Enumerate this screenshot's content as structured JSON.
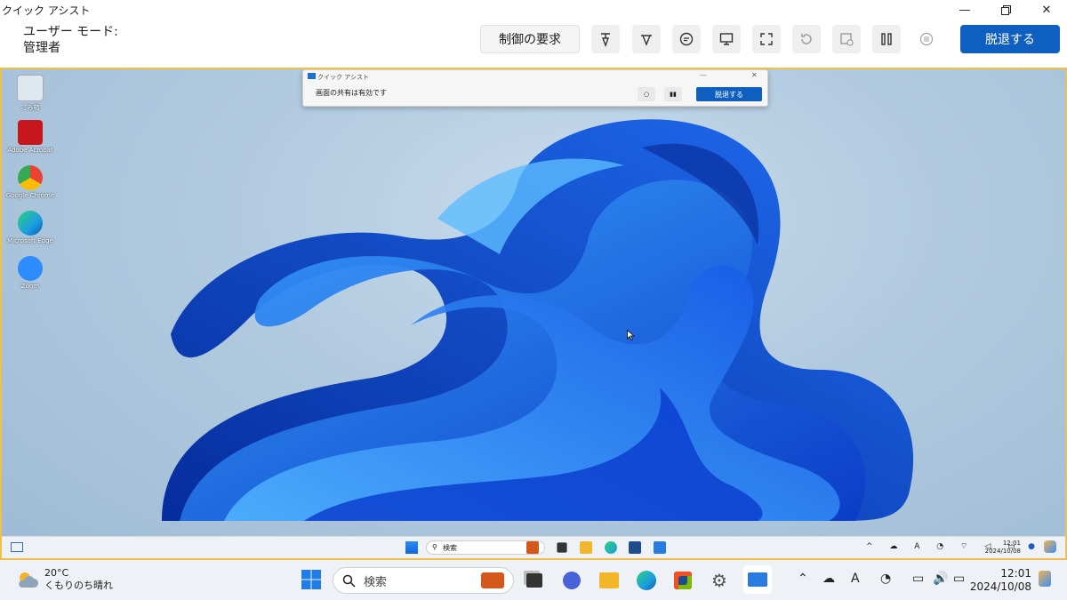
{
  "titlebar": {
    "title": "クイック アシスト"
  },
  "toolbar": {
    "mode_label": "ユーザー モード:",
    "mode_value": "管理者",
    "request_control_label": "制御の要求",
    "leave_label": "脱退する"
  },
  "remote": {
    "desktop_icons": [
      {
        "label": "ごみ箱",
        "icon": "recycle-bin-icon",
        "color": "#dfe7ef"
      },
      {
        "label": "Adobe Acrobat",
        "icon": "acrobat-icon",
        "color": "#c8161d"
      },
      {
        "label": "Google Chrome",
        "icon": "chrome-icon",
        "color": "#f1c40f"
      },
      {
        "label": "Microsoft Edge",
        "icon": "edge-icon",
        "color": "#1b9de2"
      },
      {
        "label": "Zoom",
        "icon": "zoom-icon",
        "color": "#2d8cff"
      }
    ],
    "window": {
      "title": "クイック アシスト",
      "message": "画面の共有は有効です",
      "leave_label": "脱退する"
    },
    "taskbar": {
      "search_label": "検索",
      "time": "12:01",
      "date": "2024/10/08"
    }
  },
  "taskbar": {
    "weather_temp": "20°C",
    "weather_text": "くもりのち晴れ",
    "search_label": "検索",
    "tray_ime": "A",
    "time": "12:01",
    "date": "2024/10/08"
  },
  "colors": {
    "accent": "#0f5fc0",
    "border_highlight": "#f0c04a"
  }
}
